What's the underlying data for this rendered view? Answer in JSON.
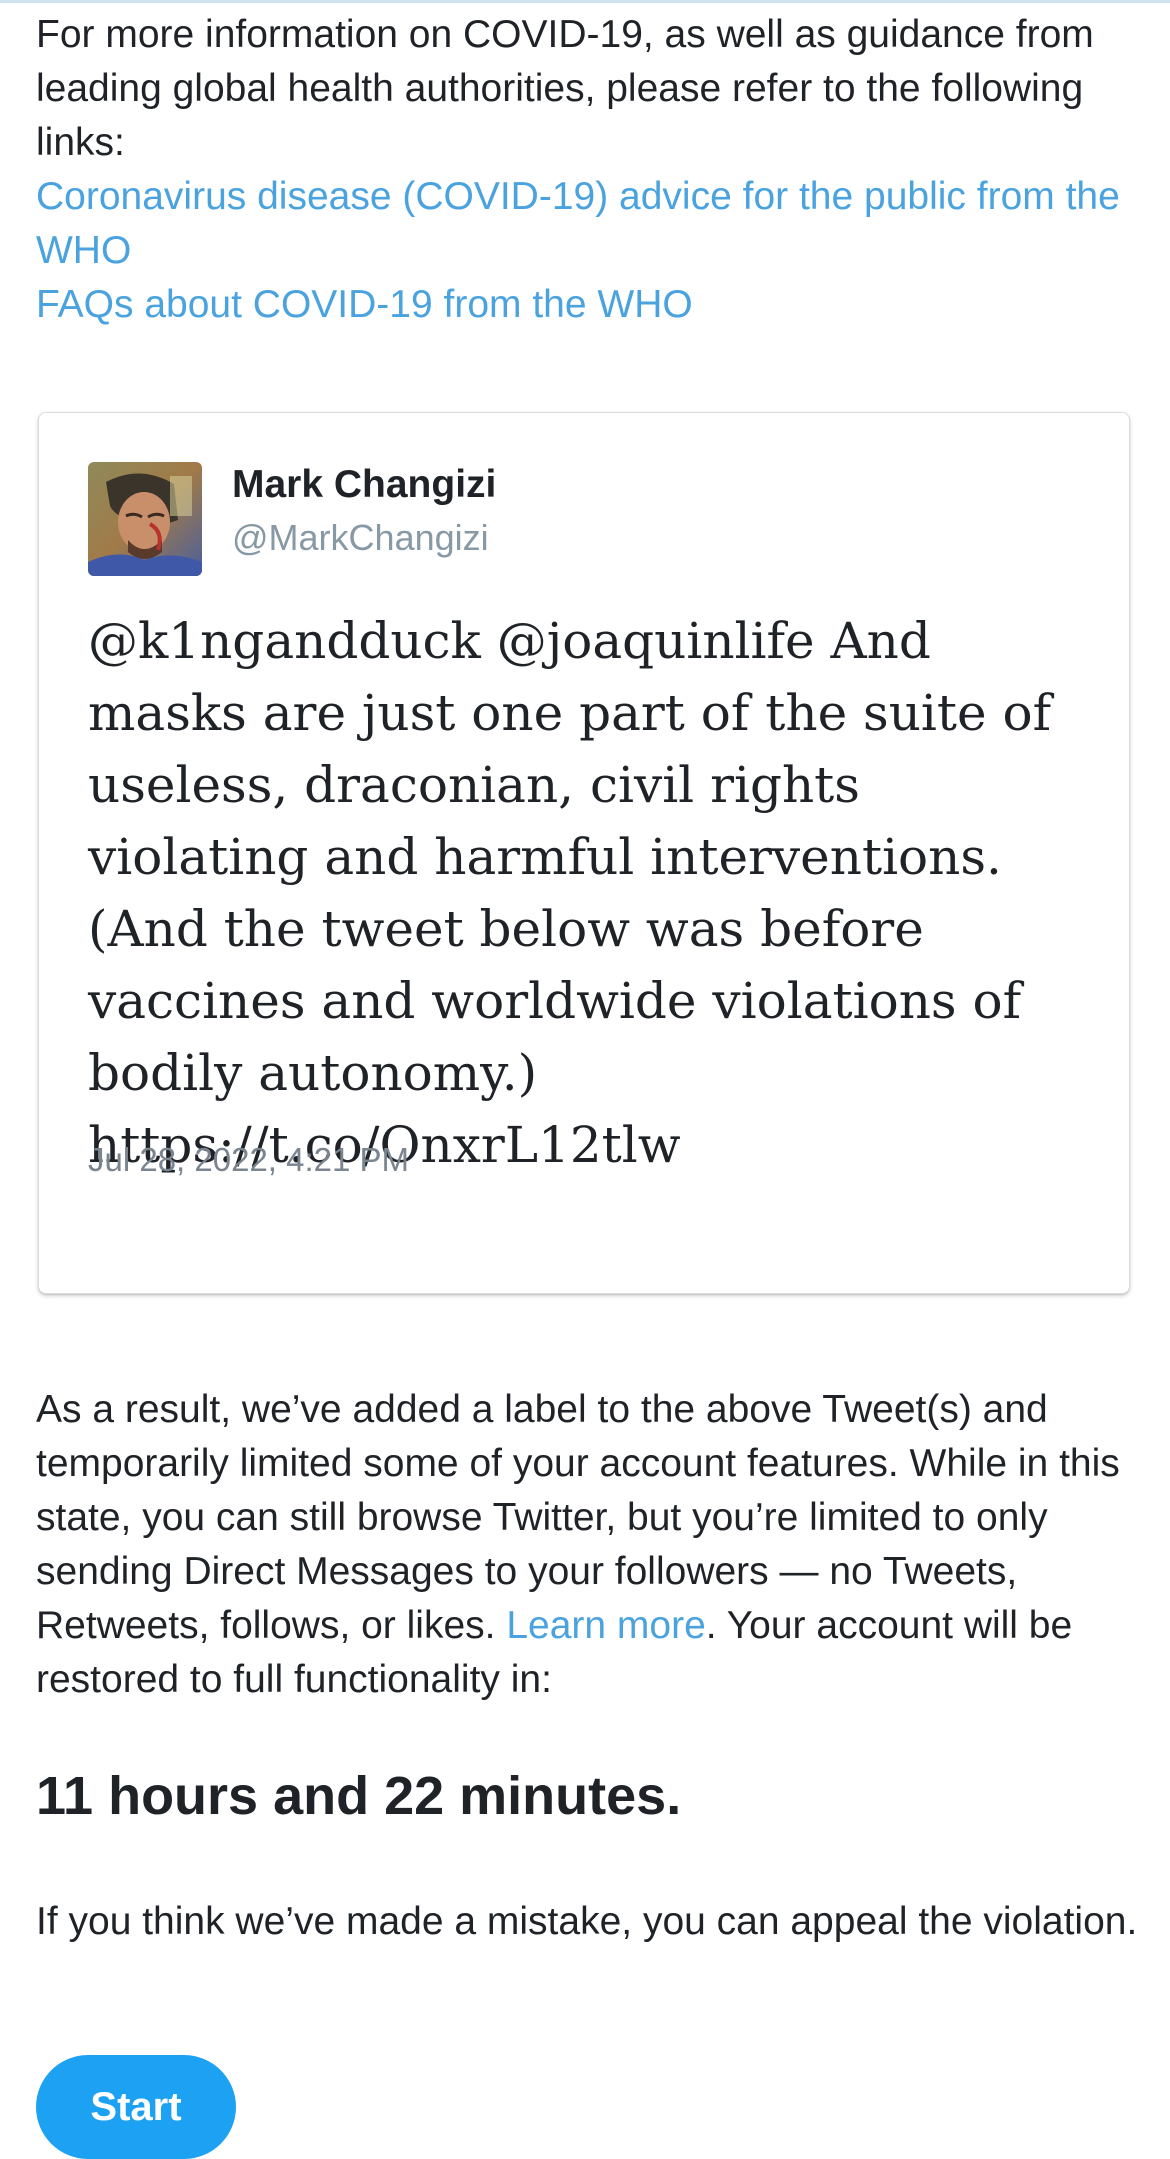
{
  "intro": {
    "text": "For more information on COVID-19, as well as guidance from leading global health authorities, please refer to the following links:",
    "links": [
      "Coronavirus disease (COVID-19) advice for the public from the WHO",
      "FAQs about COVID-19 from the WHO"
    ]
  },
  "tweet": {
    "author_name": "Mark Changizi",
    "author_handle": "@MarkChangizi",
    "text": "@k1ngandduck @joaquinlife And masks are just one part of the suite of useless, draconian, civil rights violating and harmful interventions. (And the tweet below was before vaccines and worldwide violations of bodily autonomy.) https://t.co/OnxrL12tlw",
    "timestamp": "Jul 28, 2022, 4:21 PM"
  },
  "notice": {
    "text_before_link": "As a result, we’ve added a label to the above Tweet(s) and temporarily limited some of your account features. While in this state, you can still browse Twitter, but you’re limited to only sending Direct Messages to your followers — no Tweets, Retweets, follows, or likes.",
    "learn_more": "Learn more",
    "text_after_link": ". Your account will be restored to full functionality in:",
    "countdown": "11 hours and 22 minutes.",
    "appeal": "If you think we’ve made a mistake, you can appeal the violation.",
    "start_label": "Start"
  },
  "colors": {
    "link": "#4aa3df",
    "button": "#1da1f2",
    "handle": "#8899a6"
  }
}
